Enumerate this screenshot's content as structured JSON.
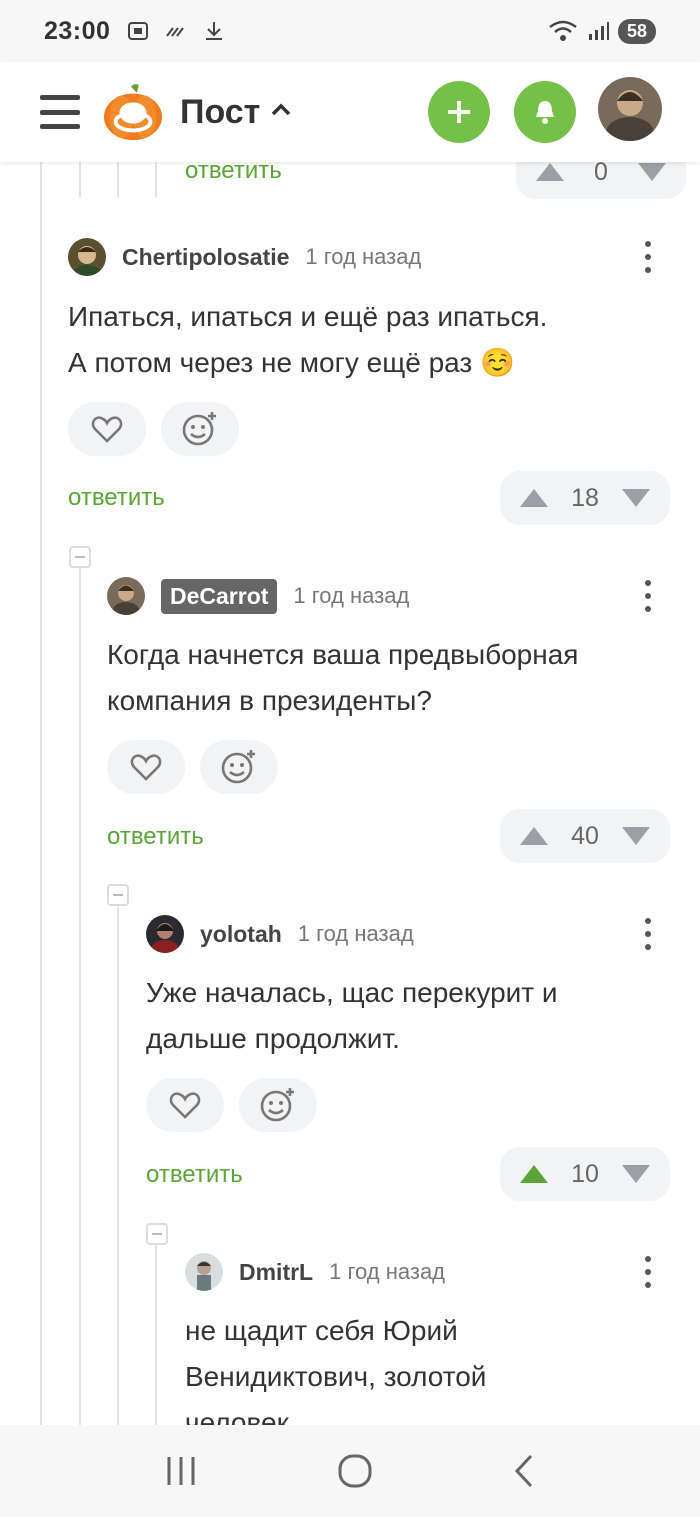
{
  "status": {
    "time": "23:00",
    "battery": "58"
  },
  "header": {
    "title": "Пост"
  },
  "top_fragment": {
    "reply_label": "ответить",
    "votes": "0"
  },
  "comments": [
    {
      "author": "Chertipolosatie",
      "time": "1 год назад",
      "text_line1": "Ипаться, ипаться и ещё раз ипаться.",
      "text_line2": "А потом через не могу ещё раз ☺️",
      "reply_label": "ответить",
      "votes": "18"
    },
    {
      "author": "DeCarrot",
      "time": "1 год назад",
      "text_line1": "Когда начнется ваша предвыборная",
      "text_line2": "компания в президенты?",
      "reply_label": "ответить",
      "votes": "40"
    },
    {
      "author": "yolotah",
      "time": "1 год назад",
      "text_line1": "Уже началась, щас перекурит и",
      "text_line2": "дальше продолжит.",
      "reply_label": "ответить",
      "votes": "10",
      "upvoted": true
    },
    {
      "author": "DmitrL",
      "time": "1 год назад",
      "text_line1": "не щадит себя Юрий",
      "text_line2": "Венидиктович, золотой",
      "text_line3": "человек"
    }
  ],
  "colors": {
    "accent": "#75c047",
    "reply": "#5aa535",
    "vote_bg": "#f2f3f5"
  },
  "icons": [
    "menu-icon",
    "pumpkin-logo",
    "chevron-up-icon",
    "plus-icon",
    "bell-icon",
    "heart-icon",
    "emoji-add-icon",
    "arrow-up-icon",
    "arrow-down-icon",
    "more-vert-icon"
  ]
}
